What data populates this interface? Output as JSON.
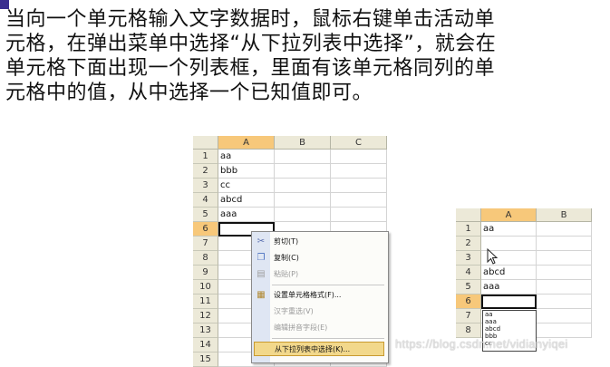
{
  "paragraph": {
    "line1": "当向一个单元格输入文字数据时，鼠标右键单击活动单",
    "line2": "元格，在弹出菜单中选择“从下拉列表中选择”，就会在",
    "line3": "单元格下面出现一个列表框，里面有该单元格同列的单",
    "line4": "元格中的值，从中选择一个已知值即可。"
  },
  "sheet1": {
    "columns": [
      "A",
      "B",
      "C"
    ],
    "selected_column": "A",
    "rows": [
      "1",
      "2",
      "3",
      "4",
      "5",
      "6",
      "7",
      "8",
      "9",
      "10",
      "11",
      "12",
      "13",
      "14",
      "15"
    ],
    "cells_a": [
      "aa",
      "bbb",
      "cc",
      "abcd",
      "aaa"
    ],
    "active_row": "6"
  },
  "context_menu": {
    "items": [
      {
        "label": "剪切(T)",
        "icon": "scissors-icon",
        "enabled": true
      },
      {
        "label": "复制(C)",
        "icon": "copy-icon",
        "enabled": true
      },
      {
        "label": "粘贴(P)",
        "icon": "paste-icon",
        "enabled": false
      },
      {
        "label": "设置单元格格式(F)...",
        "icon": "format-cells-icon",
        "enabled": true
      },
      {
        "label": "汉字重选(V)",
        "icon": "",
        "enabled": false
      },
      {
        "label": "编辑拼音字段(E)",
        "icon": "",
        "enabled": false
      },
      {
        "label": "从下拉列表中选择(K)...",
        "icon": "",
        "enabled": true,
        "highlighted": true
      }
    ]
  },
  "sheet2": {
    "columns": [
      "A",
      "B"
    ],
    "selected_column": "A",
    "rows": [
      "1",
      "2",
      "3",
      "4",
      "5",
      "6",
      "7",
      "8"
    ],
    "cells_a": [
      "aa",
      "",
      "",
      "abcd",
      "aaa"
    ],
    "active_row": "6",
    "dropdown_options": [
      "aa",
      "aaa",
      "abcd",
      "bbb",
      "cc"
    ]
  },
  "watermark": "https://blog.csdn.net/vidianyiqei",
  "colors": {
    "header": "#ece9d8",
    "selected_header": "#f7c87a",
    "menu_highlight": "#f2d88b",
    "accent": "#3a2f8f"
  }
}
